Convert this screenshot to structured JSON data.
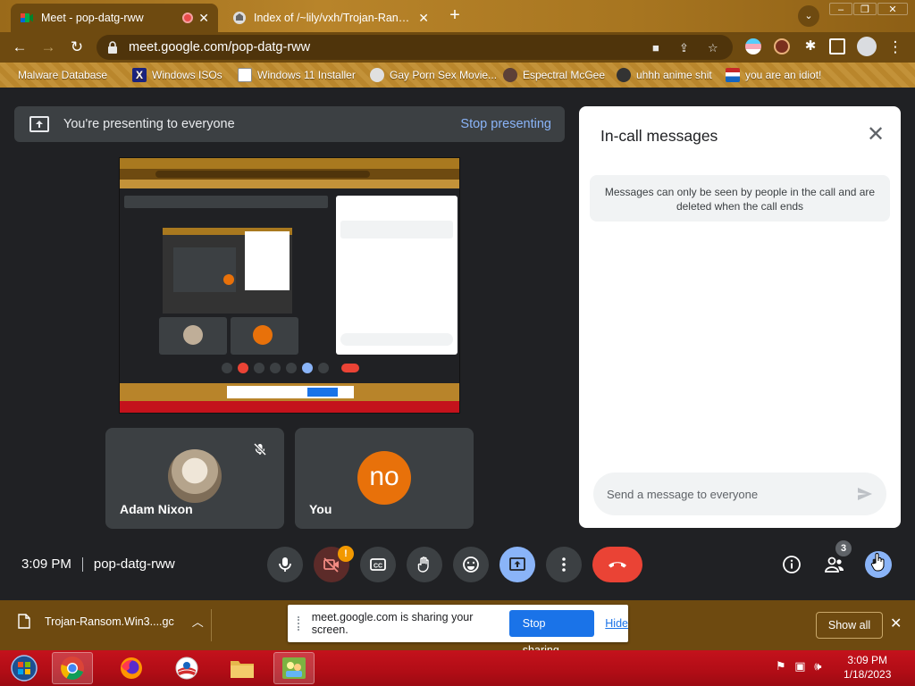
{
  "browser": {
    "tabs": [
      {
        "title": "Meet - pop-datg-rww",
        "active": true,
        "recording": true
      },
      {
        "title": "Index of /~lily/vxh/Trojan-Ransom",
        "active": false
      }
    ],
    "new_tab_icon": "plus-icon",
    "url": "meet.google.com/pop-datg-rww",
    "bookmarks": [
      {
        "label": "Malware Database"
      },
      {
        "label": "Windows ISOs"
      },
      {
        "label": "Windows 11 Installer"
      },
      {
        "label": "Gay Porn Sex Movie..."
      },
      {
        "label": "Espectral McGee"
      },
      {
        "label": "uhhh anime shit"
      },
      {
        "label": "you are an idiot!"
      }
    ]
  },
  "meet": {
    "presenting_banner": "You're presenting to everyone",
    "stop_presenting": "Stop presenting",
    "participants": [
      {
        "name": "Adam Nixon",
        "muted": true
      },
      {
        "name": "You",
        "initials": "no",
        "avatar_color": "#e8710a"
      }
    ],
    "time": "3:09 PM",
    "meeting_code": "pop-datg-rww",
    "participant_count": "3",
    "camera_alert": "!",
    "chat": {
      "title": "In-call messages",
      "notice": "Messages can only be seen by people in the call and are deleted when the call ends",
      "input_placeholder": "Send a message to everyone"
    }
  },
  "downloads": {
    "file": "Trojan-Ransom.Win3....gc",
    "show_all": "Show all"
  },
  "share_bar": {
    "message": "meet.google.com is sharing your screen.",
    "stop_sharing": "Stop sharing",
    "hide": "Hide"
  },
  "taskbar": {
    "time": "3:09 PM",
    "date": "1/18/2023"
  },
  "colors": {
    "accent_blue": "#8ab4f8",
    "end_call_red": "#ea4335",
    "chrome_theme": "#6e4a10",
    "taskbar_red": "#c4121c"
  }
}
